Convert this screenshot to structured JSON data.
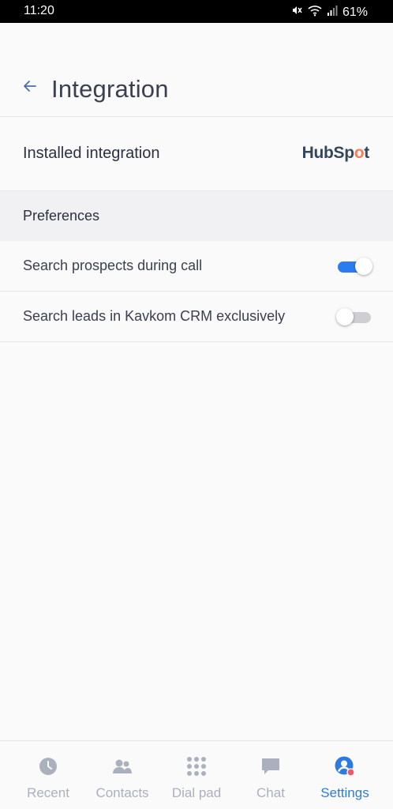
{
  "status_bar": {
    "time": "11:20",
    "battery": "61%"
  },
  "header": {
    "title": "Integration"
  },
  "installed": {
    "label": "Installed integration",
    "logo_text_a": "HubSp",
    "logo_text_b": "t"
  },
  "preferences": {
    "section_label": "Preferences",
    "items": [
      {
        "label": "Search prospects during call",
        "enabled": true
      },
      {
        "label": "Search leads in Kavkom CRM exclusively",
        "enabled": false
      }
    ]
  },
  "bottom_nav": {
    "items": [
      {
        "label": "Recent",
        "icon": "clock-icon",
        "active": false
      },
      {
        "label": "Contacts",
        "icon": "contacts-icon",
        "active": false
      },
      {
        "label": "Dial pad",
        "icon": "dialpad-icon",
        "active": false
      },
      {
        "label": "Chat",
        "icon": "chat-icon",
        "active": false
      },
      {
        "label": "Settings",
        "icon": "settings-user-icon",
        "active": true
      }
    ]
  },
  "colors": {
    "accent": "#2b7cf0",
    "active_nav": "#2d7bdc",
    "inactive_nav": "#aab0bd",
    "hubspot_orange": "#ff7a59"
  }
}
